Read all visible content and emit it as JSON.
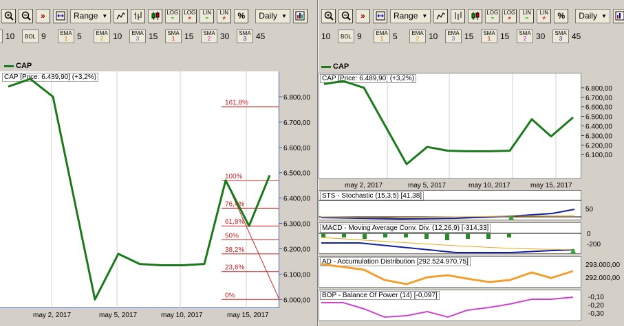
{
  "toolbar": {
    "range_label": "Range",
    "interval_label": "Daily",
    "log_label": "LOG",
    "lin_label": "LIN",
    "percent_label": "%"
  },
  "indicators": {
    "first_value": "10",
    "bol_label": "BOL",
    "bol_value": "9",
    "ema_label": "EMA",
    "ema1_num": "1",
    "ema1_value": "5",
    "ema2_num": "2",
    "ema2_value": "10",
    "ema3_num": "3",
    "ema3_value": "15",
    "sma_label": "SMA",
    "sma1_num": "1",
    "sma1_value": "15",
    "sma2_num": "2",
    "sma2_value": "30",
    "sma3_num": "3",
    "sma3_value": "45"
  },
  "colors": {
    "price_line": "#1a7a1a",
    "fib": "#cc2222",
    "macd_signal": "#e6a817",
    "ad_line": "#f0a030",
    "bop_line": "#cc44cc",
    "ma_blue": "#1020a0"
  },
  "left_chart": {
    "legend": "CAP",
    "label": "CAP [Price: 6.489,90] (+3,2%)",
    "x_labels": [
      "may 2, 2017",
      "may 5, 2017",
      "may 10, 2017",
      "may 15, 2017"
    ],
    "y_labels": [
      "6.800,00",
      "6.700,00",
      "6.600,00",
      "6.500,00",
      "6.400,00",
      "6.300,00",
      "6.200,00",
      "6.100,00",
      "6.000,00"
    ],
    "fib_levels": [
      "161,8%",
      "100%",
      "76,4%",
      "61,8%",
      "50%",
      "38,2%",
      "23,6%",
      "0%"
    ]
  },
  "right_chart": {
    "legend": "CAP",
    "label": "CAP [Price: 6.489,90] (+3,2%)",
    "x_labels": [
      "may 2, 2017",
      "may 5, 2017",
      "may 10, 2017",
      "may 15, 2017"
    ],
    "y_labels": [
      "6.800,00",
      "6.700,00",
      "6.600,00",
      "6.500,00",
      "6.400,00",
      "6.300,00",
      "6.200,00",
      "6.100,00"
    ]
  },
  "subcharts": {
    "sts_label": "STS - Stochastic (15,3,5) [41,38]",
    "sts_y": [
      "50"
    ],
    "macd_label": "MACD - Moving Average Conv. Div. (12,26,9) [-314,33]",
    "macd_y": [
      "0",
      "-200"
    ],
    "ad_label": "AD - Accumulation Distribution [292.524.970,75]",
    "ad_y": [
      "293.000,00",
      "292.000,00"
    ],
    "bop_label": "BOP - Balance Of Power (14) [-0,097]",
    "bop_y": [
      "-0,10",
      "-0,20",
      "-0,30"
    ]
  },
  "chart_data": [
    {
      "type": "line",
      "title": "CAP [Price: 6.489,90] (+3,2%)",
      "series": [
        {
          "name": "CAP",
          "values": [
            6840,
            6870,
            6800,
            6000,
            6180,
            6140,
            6135,
            6135,
            6140,
            6470,
            6290,
            6490
          ]
        }
      ],
      "x_ticks": [
        "may 2, 2017",
        "may 5, 2017",
        "may 10, 2017",
        "may 15, 2017"
      ],
      "ylim": [
        5990,
        6900
      ],
      "annotations": {
        "fibonacci": [
          "161,8%",
          "100%",
          "76,4%",
          "61,8%",
          "50%",
          "38,2%",
          "23,6%",
          "0%"
        ]
      }
    },
    {
      "type": "line",
      "title": "CAP [Price: 6.489,90] (+3,2%)",
      "series": [
        {
          "name": "CAP",
          "values": [
            6840,
            6870,
            6800,
            6000,
            6180,
            6140,
            6135,
            6135,
            6140,
            6470,
            6290,
            6490
          ]
        }
      ],
      "x_ticks": [
        "may 2, 2017",
        "may 5, 2017",
        "may 10, 2017",
        "may 15, 2017"
      ],
      "ylim": [
        5900,
        6900
      ]
    }
  ]
}
